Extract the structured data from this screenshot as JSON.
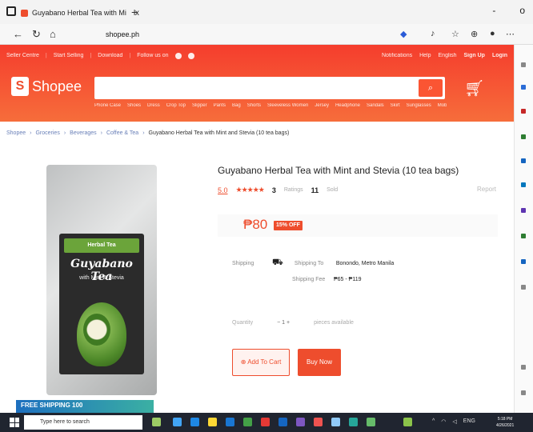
{
  "browser": {
    "tab_title": "Guyabano Herbal Tea with Mi",
    "tab_close": "x",
    "new_tab": "+",
    "url": "shopee.ph",
    "minimize": "-",
    "maximize": "o"
  },
  "topbar": {
    "left": [
      "Seller Centre",
      "Start Selling",
      "Download",
      "Follow us on"
    ],
    "right": [
      "Notifications",
      "Help",
      "English",
      "Sign Up",
      "Login"
    ]
  },
  "header": {
    "logo_text": "Shopee",
    "search_placeholder": "",
    "search_icon": "search-icon",
    "cart_icon": "cart-icon",
    "hotwords": [
      "Phone Case",
      "Shoes",
      "Dress",
      "Crop Top",
      "Slipper",
      "Pants",
      "Bag",
      "Shorts",
      "Sleeveless Women",
      "Jersey",
      "Headphone",
      "Sandals",
      "Skirt",
      "Sunglasses",
      "Mobile Phone"
    ]
  },
  "breadcrumb": {
    "items": [
      "Shopee",
      "Groceries",
      "Beverages",
      "Coffee & Tea"
    ],
    "current": "Guyabano Herbal Tea with Mint and Stevia (10 tea bags)"
  },
  "product": {
    "title": "Guyabano Herbal Tea with Mint and Stevia (10 tea bags)",
    "rating": "5.0",
    "stars": "★★★★★",
    "ratings_count": "3",
    "ratings_label": "Ratings",
    "sold_count": "11",
    "sold_label": "Sold",
    "report": "Report",
    "price": "₱80",
    "discount": "15% OFF",
    "pack_brand": "Herbal Tea",
    "pack_name": "Guyabano Tea",
    "pack_sub": "with Mint & Stevia",
    "promo": "FREE SHIPPING 100"
  },
  "shipping": {
    "section_label": "Shipping",
    "to_label": "Shipping To",
    "to_value": "Bonondo, Metro Manila",
    "fee_label": "Shipping Fee",
    "fee_value": "₱65 - ₱119"
  },
  "quantity": {
    "label": "Quantity",
    "value": "1",
    "available": "pieces available"
  },
  "actions": {
    "add_to_cart": "Add To Cart",
    "buy_now": "Buy Now"
  },
  "taskbar": {
    "search_text": "Type here to search",
    "time": "5:18 PM",
    "date": "4/26/2021"
  }
}
